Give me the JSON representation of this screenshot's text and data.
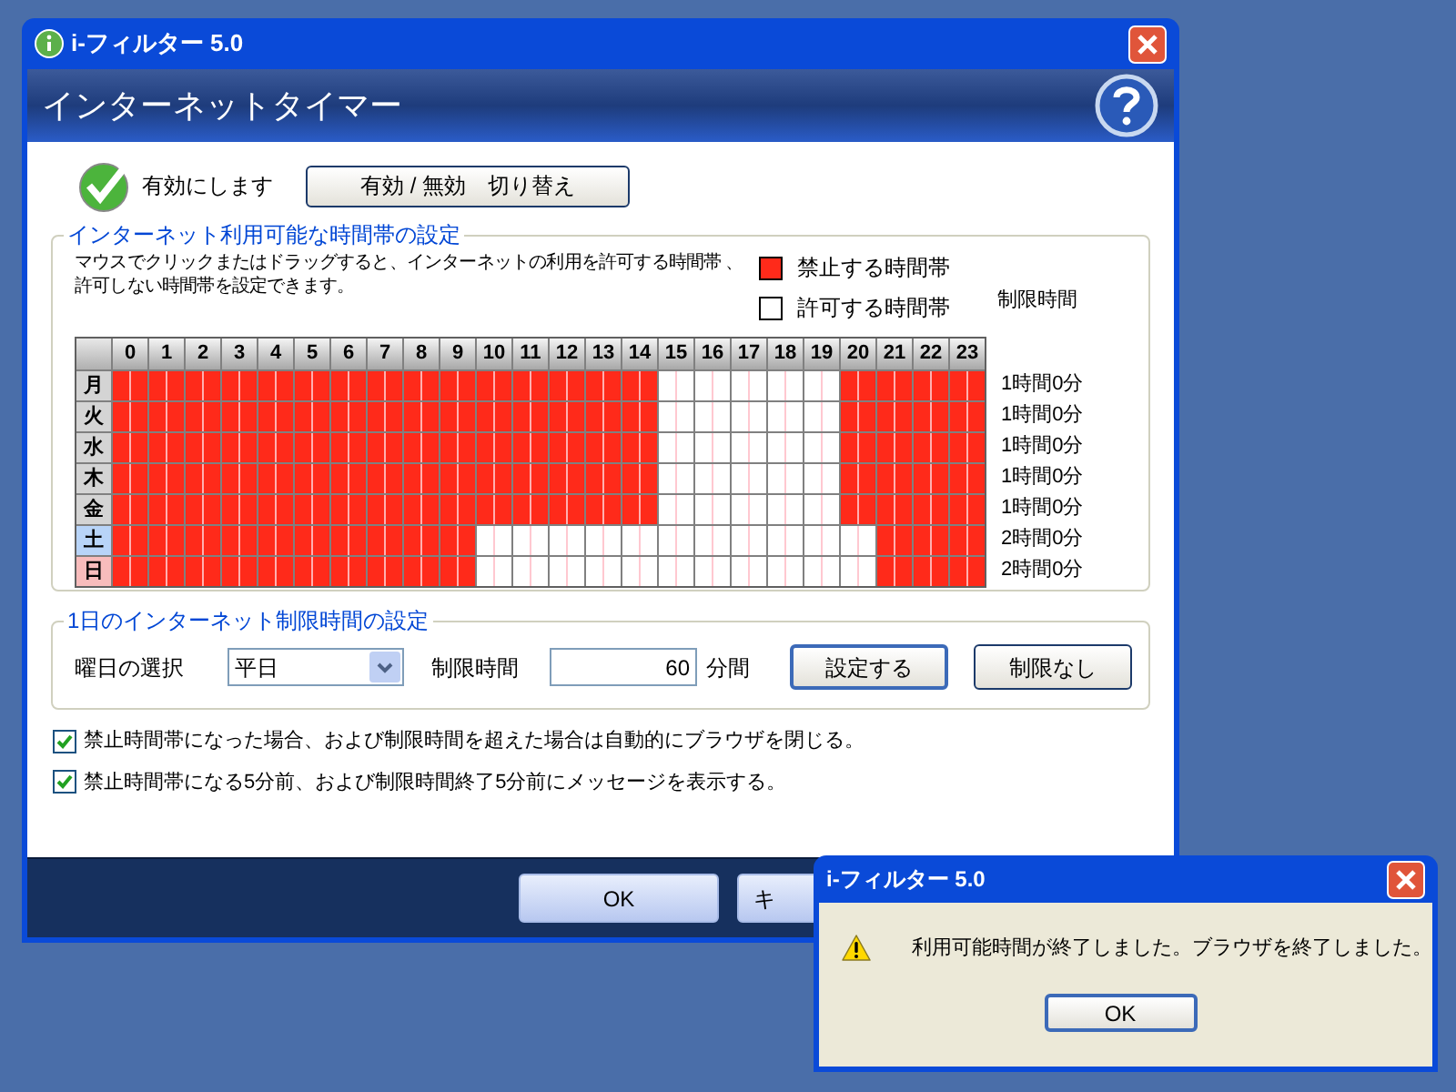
{
  "window": {
    "title": "i-フィルター 5.0",
    "header": "インターネットタイマー"
  },
  "enable": {
    "label": "有効にします",
    "checked": true,
    "toggle_button": "有効 / 無効　切り替え"
  },
  "schedule": {
    "legend": "インターネット利用可能な時間帯の設定",
    "description": [
      "マウスでクリックまたはドラッグすると、インターネットの利用を許可する時間帯 、",
      "許可しない時間帯を設定できます。"
    ],
    "legend_blocked": "禁止する時間帯",
    "legend_allowed": "許可する時間帯",
    "limit_heading": "制限時間",
    "hours": [
      "0",
      "1",
      "2",
      "3",
      "4",
      "5",
      "6",
      "7",
      "8",
      "9",
      "10",
      "11",
      "12",
      "13",
      "14",
      "15",
      "16",
      "17",
      "18",
      "19",
      "20",
      "21",
      "22",
      "23"
    ],
    "days": [
      {
        "label": "月",
        "color": "#d4d4d4",
        "limit": "1時間0分",
        "blocked": [
          true,
          true,
          true,
          true,
          true,
          true,
          true,
          true,
          true,
          true,
          true,
          true,
          true,
          true,
          true,
          false,
          false,
          false,
          false,
          false,
          true,
          true,
          true,
          true
        ]
      },
      {
        "label": "火",
        "color": "#d4d4d4",
        "limit": "1時間0分",
        "blocked": [
          true,
          true,
          true,
          true,
          true,
          true,
          true,
          true,
          true,
          true,
          true,
          true,
          true,
          true,
          true,
          false,
          false,
          false,
          false,
          false,
          true,
          true,
          true,
          true
        ]
      },
      {
        "label": "水",
        "color": "#d4d4d4",
        "limit": "1時間0分",
        "blocked": [
          true,
          true,
          true,
          true,
          true,
          true,
          true,
          true,
          true,
          true,
          true,
          true,
          true,
          true,
          true,
          false,
          false,
          false,
          false,
          false,
          true,
          true,
          true,
          true
        ]
      },
      {
        "label": "木",
        "color": "#d4d4d4",
        "limit": "1時間0分",
        "blocked": [
          true,
          true,
          true,
          true,
          true,
          true,
          true,
          true,
          true,
          true,
          true,
          true,
          true,
          true,
          true,
          false,
          false,
          false,
          false,
          false,
          true,
          true,
          true,
          true
        ]
      },
      {
        "label": "金",
        "color": "#d4d4d4",
        "limit": "1時間0分",
        "blocked": [
          true,
          true,
          true,
          true,
          true,
          true,
          true,
          true,
          true,
          true,
          true,
          true,
          true,
          true,
          true,
          false,
          false,
          false,
          false,
          false,
          true,
          true,
          true,
          true
        ]
      },
      {
        "label": "土",
        "color": "#b8d4f8",
        "limit": "2時間0分",
        "blocked": [
          true,
          true,
          true,
          true,
          true,
          true,
          true,
          true,
          true,
          true,
          false,
          false,
          false,
          false,
          false,
          false,
          false,
          false,
          false,
          false,
          false,
          true,
          true,
          true
        ]
      },
      {
        "label": "日",
        "color": "#f8bcbc",
        "limit": "2時間0分",
        "blocked": [
          true,
          true,
          true,
          true,
          true,
          true,
          true,
          true,
          true,
          true,
          false,
          false,
          false,
          false,
          false,
          false,
          false,
          false,
          false,
          false,
          false,
          true,
          true,
          true
        ]
      }
    ]
  },
  "daily": {
    "legend": "1日のインターネット制限時間の設定",
    "day_label": "曜日の選択",
    "day_value": "平日",
    "limit_label": "制限時間",
    "minutes": "60",
    "unit": "分間",
    "set_button": "設定する",
    "nolimit_button": "制限なし"
  },
  "options": [
    {
      "label": "禁止時間帯になった場合、および制限時間を超えた場合は自動的にブラウザを閉じる。",
      "checked": true
    },
    {
      "label": "禁止時間帯になる5分前、および制限時間終了5分前にメッセージを表示する。",
      "checked": true
    }
  ],
  "footer_buttons": [
    "OK",
    "キ"
  ],
  "dialog": {
    "title": "i-フィルター 5.0",
    "message": "利用可能時間が終了しました。ブラウザを終了しました。",
    "button": "OK"
  }
}
